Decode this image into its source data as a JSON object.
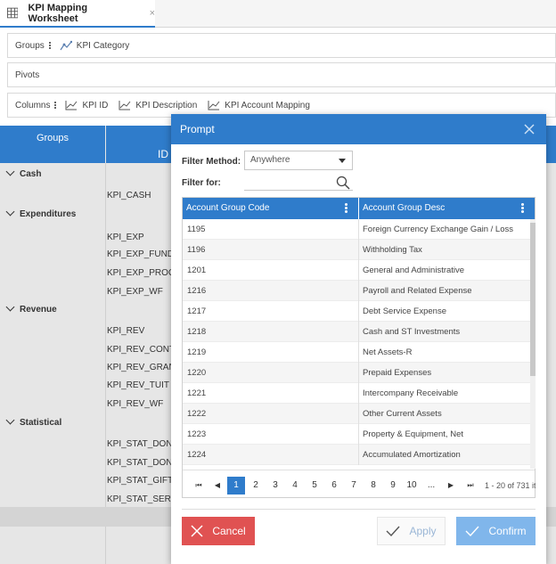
{
  "tab": {
    "title": "KPI Mapping Worksheet",
    "close": "×"
  },
  "toolbars": {
    "groups_label": "Groups",
    "groups_chip": "KPI Category",
    "pivots_label": "Pivots",
    "columns_label": "Columns",
    "columns_chips": [
      "KPI ID",
      "KPI Description",
      "KPI Account Mapping"
    ]
  },
  "grid": {
    "header_groups": "Groups",
    "header_id": "ID",
    "groups": [
      "Cash",
      "Expenditures",
      "Revenue",
      "Statistical"
    ],
    "kpis": [
      "KPI_CASH",
      "KPI_EXP",
      "KPI_EXP_FUND",
      "KPI_EXP_PROG",
      "KPI_EXP_WF",
      "KPI_REV",
      "KPI_REV_CONT",
      "KPI_REV_GRAN",
      "KPI_REV_TUIT",
      "KPI_REV_WF",
      "KPI_STAT_DON",
      "KPI_STAT_DON",
      "KPI_STAT_GIFT",
      "KPI_STAT_SERV"
    ]
  },
  "dialog": {
    "title": "Prompt",
    "filter_method_label": "Filter Method:",
    "filter_method_value": "Anywhere",
    "filter_for_label": "Filter for:",
    "filter_for_value": "",
    "columns": [
      "Account Group Code",
      "Account Group Desc"
    ],
    "rows": [
      {
        "code": "1195",
        "desc": "Foreign Currency Exchange Gain / Loss"
      },
      {
        "code": "1196",
        "desc": "Withholding Tax"
      },
      {
        "code": "1201",
        "desc": "General and Administrative"
      },
      {
        "code": "1216",
        "desc": "Payroll and Related Expense"
      },
      {
        "code": "1217",
        "desc": "Debt Service Expense"
      },
      {
        "code": "1218",
        "desc": "Cash and ST Investments"
      },
      {
        "code": "1219",
        "desc": "Net Assets-R"
      },
      {
        "code": "1220",
        "desc": "Prepaid Expenses"
      },
      {
        "code": "1221",
        "desc": "Intercompany Receivable"
      },
      {
        "code": "1222",
        "desc": "Other Current Assets"
      },
      {
        "code": "1223",
        "desc": "Property & Equipment, Net"
      },
      {
        "code": "1224",
        "desc": "Accumulated Amortization"
      }
    ],
    "pager": {
      "first": "⏮",
      "prev": "◀",
      "next": "▶",
      "last": "⏭",
      "pages": [
        "1",
        "2",
        "3",
        "4",
        "5",
        "6",
        "7",
        "8",
        "9",
        "10",
        "..."
      ],
      "current": "1",
      "info": "1 - 20 of 731 it"
    },
    "buttons": {
      "cancel": "Cancel",
      "apply": "Apply",
      "confirm": "Confirm"
    }
  }
}
